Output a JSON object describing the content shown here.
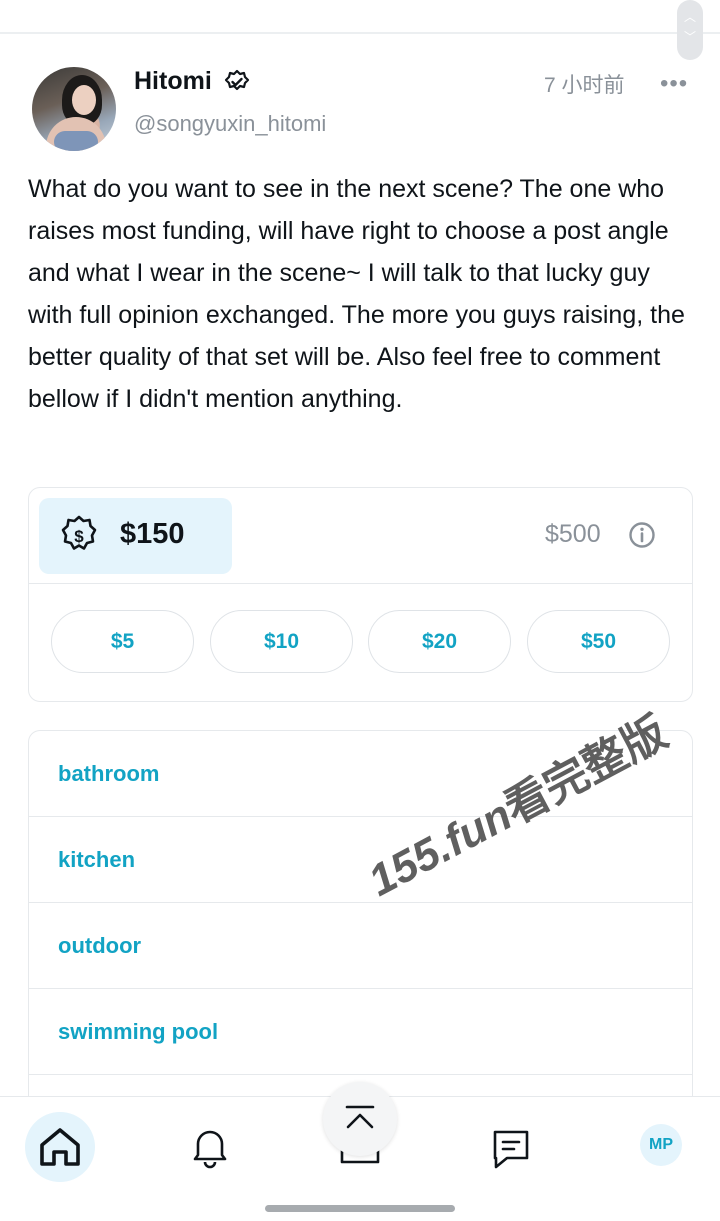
{
  "post": {
    "author_name": "Hitomi",
    "author_handle": "@songyuxin_hitomi",
    "timestamp": "7 小时前",
    "body": "What do you want to see in the next scene? The one who raises most funding, will have right to choose a post angle and what I wear in the scene~ I will talk to that lucky guy with full opinion exchanged. The more you guys raising, the better quality of that set will be. Also feel free to comment bellow if I didn't mention anything."
  },
  "funding": {
    "raised": "$150",
    "goal": "$500",
    "raised_progress": 0.3,
    "amounts": [
      "$5",
      "$10",
      "$20",
      "$50"
    ]
  },
  "poll_options": [
    "bathroom",
    "kitchen",
    "outdoor",
    "swimming pool"
  ],
  "watermark": {
    "latin": "155.fun",
    "cn": "看完整版"
  },
  "nav": {
    "profile_initials": "MP"
  },
  "colors": {
    "accent": "#12a3c4",
    "accent_bg": "#e4f4fc",
    "muted": "#8a9199"
  }
}
